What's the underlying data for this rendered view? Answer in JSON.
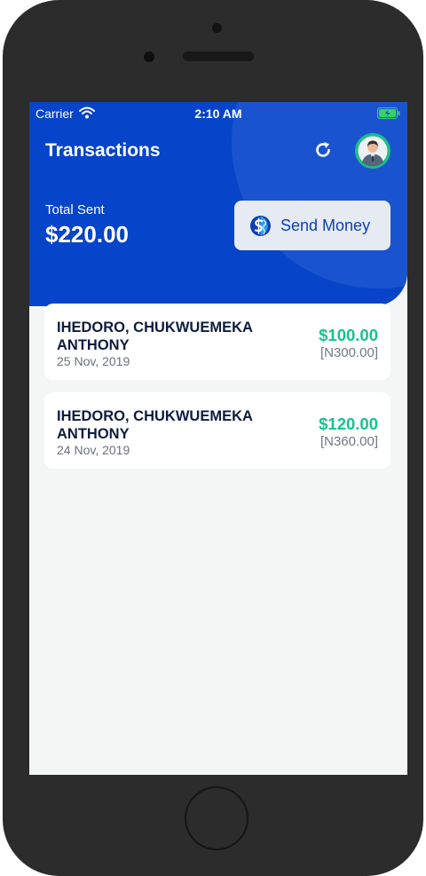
{
  "status_bar": {
    "carrier": "Carrier",
    "time": "2:10 AM"
  },
  "header": {
    "title": "Transactions",
    "total_label": "Total Sent",
    "total_value": "$220.00",
    "send_button_label": "Send Money"
  },
  "transactions": [
    {
      "name": "IHEDORO, CHUKWUEMEKA ANTHONY",
      "date": "25 Nov, 2019",
      "amount": "$100.00",
      "local_amount": "[N300.00]"
    },
    {
      "name": "IHEDORO, CHUKWUEMEKA ANTHONY",
      "date": "24 Nov, 2019",
      "amount": "$120.00",
      "local_amount": "[N360.00]"
    }
  ],
  "icons": {
    "wifi": "wifi-icon",
    "battery": "battery-charging-icon",
    "refresh": "refresh-icon",
    "avatar": "user-avatar-icon",
    "send": "globe-dollar-icon"
  },
  "colors": {
    "brand_blue": "#0644c9",
    "amount_green": "#16c38c",
    "avatar_green": "#1dbf87",
    "screen_bg": "#f4f6f6",
    "phone_body": "#2b2c2b"
  }
}
